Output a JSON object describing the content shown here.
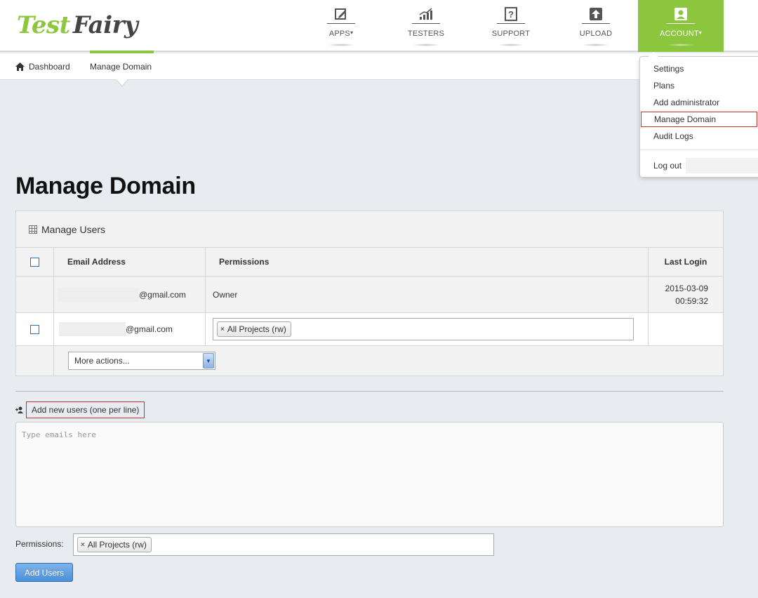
{
  "header": {
    "logo_part1": "Test",
    "logo_part2": "Fairy",
    "nav": [
      {
        "label": "APPS",
        "icon": "edit-icon",
        "has_caret": true
      },
      {
        "label": "TESTERS",
        "icon": "bar-chart-icon",
        "has_caret": false
      },
      {
        "label": "SUPPORT",
        "icon": "question-icon",
        "has_caret": false
      },
      {
        "label": "UPLOAD",
        "icon": "upload-icon",
        "has_caret": false
      },
      {
        "label": "ACCOUNT",
        "icon": "user-icon",
        "has_caret": true,
        "active": true
      }
    ],
    "caret": "▾"
  },
  "breadcrumb": {
    "home": "Dashboard",
    "current": "Manage Domain"
  },
  "account_menu": {
    "items": [
      "Settings",
      "Plans",
      "Add administrator",
      "Manage Domain",
      "Audit Logs"
    ],
    "selected": "Manage Domain",
    "logout": "Log out"
  },
  "page_title": "Manage Domain",
  "manage_users": {
    "heading": "Manage Users",
    "columns": [
      "Email Address",
      "Permissions",
      "Last Login"
    ],
    "rows": [
      {
        "email_suffix": "@gmail.com",
        "permissions": "Owner",
        "last_login_date": "2015-03-09",
        "last_login_time": "00:59:32"
      },
      {
        "email_suffix": "@gmail.com",
        "permission_tag": "All Projects (rw)",
        "last_login_date": "",
        "last_login_time": ""
      }
    ],
    "bulk_action": "More actions..."
  },
  "add_users": {
    "label": "Add new users (one per line)",
    "placeholder": "Type emails here",
    "permissions_label": "Permissions:",
    "permission_tag": "All Projects (rw)",
    "submit": "Add Users"
  },
  "colors": {
    "brand_green": "#8cc63e",
    "highlight_red": "#c9302c",
    "button_blue": "#4a8fd9"
  }
}
